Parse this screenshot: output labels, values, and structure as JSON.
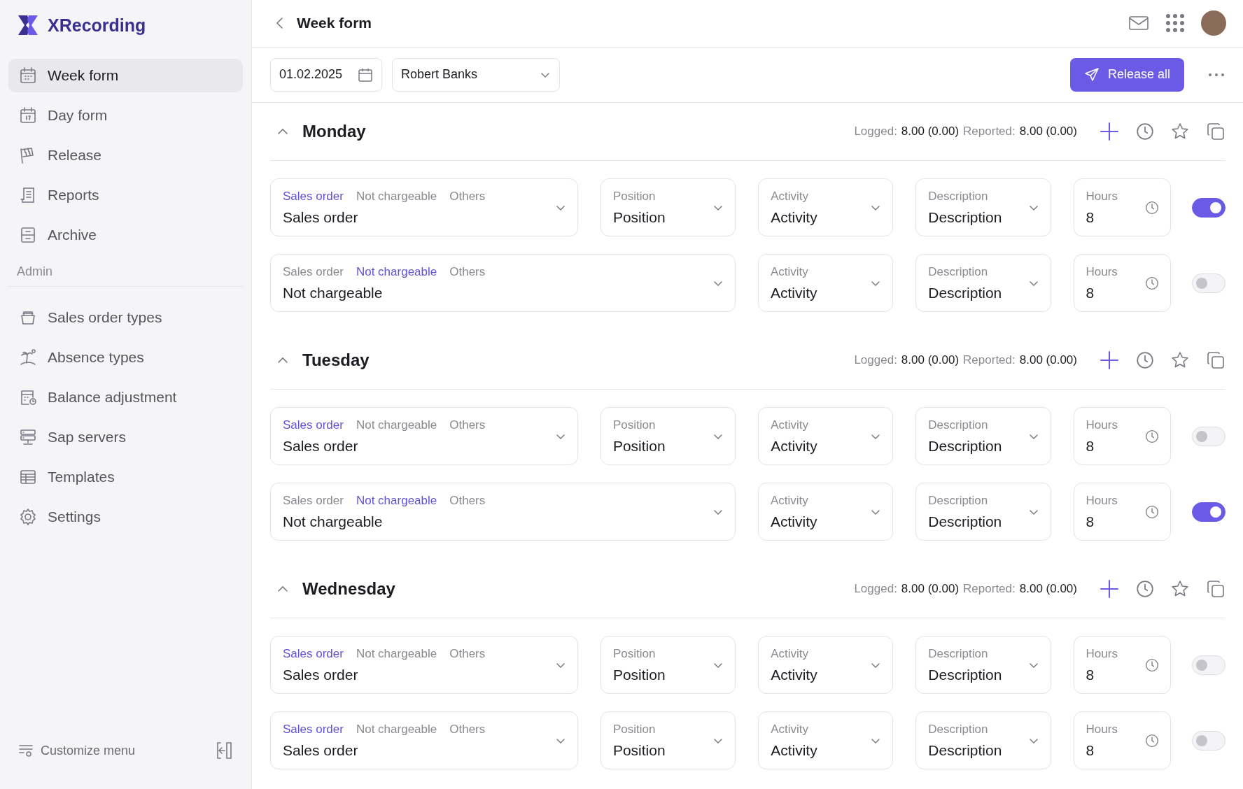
{
  "app": {
    "name": "XRecording"
  },
  "sidebar": {
    "items": [
      {
        "label": "Week form",
        "selected": true
      },
      {
        "label": "Day form",
        "selected": false
      },
      {
        "label": "Release",
        "selected": false
      },
      {
        "label": "Reports",
        "selected": false
      },
      {
        "label": "Archive",
        "selected": false
      }
    ],
    "admin_label": "Admin",
    "admin_items": [
      {
        "label": "Sales order types",
        "selected": false
      },
      {
        "label": "Absence types",
        "selected": false
      },
      {
        "label": "Balance adjustment",
        "selected": false
      },
      {
        "label": "Sap servers",
        "selected": false
      },
      {
        "label": "Templates",
        "selected": false
      },
      {
        "label": "Settings",
        "selected": false
      }
    ],
    "footer": {
      "label": "Customize menu"
    }
  },
  "header": {
    "title": "Week form"
  },
  "toolbar": {
    "date": "01.02.2025",
    "person": "Robert Banks",
    "release_button": "Release all"
  },
  "days": [
    {
      "name": "Monday",
      "expanded": true,
      "stats": [
        {
          "label": "Logged:",
          "value": "8.00 (0.00)"
        },
        {
          "label": "Reported:",
          "value": "8.00 (0.00)"
        }
      ],
      "entries": [
        {
          "kind": "sales_order",
          "segments": [
            {
              "label": "Sales order",
              "selected": true
            },
            {
              "label": "Not chargeable",
              "selected": false
            },
            {
              "label": "Others",
              "selected": false
            }
          ],
          "value": "Sales order",
          "position": {
            "label": "Position",
            "value": "Position"
          },
          "activity": {
            "label": "Activity",
            "value": "Activity"
          },
          "description": {
            "label": "Description",
            "value": "Description"
          },
          "hours": {
            "label": "Hours",
            "value": "8"
          },
          "on": true
        },
        {
          "kind": "not_chargeable",
          "segments": [
            {
              "label": "Sales order",
              "selected": false
            },
            {
              "label": "Not chargeable",
              "selected": true
            },
            {
              "label": "Others",
              "selected": false
            }
          ],
          "value": "Not chargeable",
          "activity": {
            "label": "Activity",
            "value": "Activity"
          },
          "description": {
            "label": "Description",
            "value": "Description"
          },
          "hours": {
            "label": "Hours",
            "value": "8"
          },
          "on": false
        }
      ]
    },
    {
      "name": "Tuesday",
      "expanded": true,
      "stats": [
        {
          "label": "Logged:",
          "value": "8.00 (0.00)"
        },
        {
          "label": "Reported:",
          "value": "8.00 (0.00)"
        }
      ],
      "entries": [
        {
          "kind": "sales_order",
          "segments": [
            {
              "label": "Sales order",
              "selected": true
            },
            {
              "label": "Not chargeable",
              "selected": false
            },
            {
              "label": "Others",
              "selected": false
            }
          ],
          "value": "Sales order",
          "position": {
            "label": "Position",
            "value": "Position"
          },
          "activity": {
            "label": "Activity",
            "value": "Activity"
          },
          "description": {
            "label": "Description",
            "value": "Description"
          },
          "hours": {
            "label": "Hours",
            "value": "8"
          },
          "on": false
        },
        {
          "kind": "not_chargeable",
          "segments": [
            {
              "label": "Sales order",
              "selected": false
            },
            {
              "label": "Not chargeable",
              "selected": true
            },
            {
              "label": "Others",
              "selected": false
            }
          ],
          "value": "Not chargeable",
          "activity": {
            "label": "Activity",
            "value": "Activity"
          },
          "description": {
            "label": "Description",
            "value": "Description"
          },
          "hours": {
            "label": "Hours",
            "value": "8"
          },
          "on": true
        }
      ]
    },
    {
      "name": "Wednesday",
      "expanded": true,
      "stats": [
        {
          "label": "Logged:",
          "value": "8.00 (0.00)"
        },
        {
          "label": "Reported:",
          "value": "8.00 (0.00)"
        }
      ],
      "entries": [
        {
          "kind": "sales_order",
          "segments": [
            {
              "label": "Sales order",
              "selected": true
            },
            {
              "label": "Not chargeable",
              "selected": false
            },
            {
              "label": "Others",
              "selected": false
            }
          ],
          "value": "Sales order",
          "position": {
            "label": "Position",
            "value": "Position"
          },
          "activity": {
            "label": "Activity",
            "value": "Activity"
          },
          "description": {
            "label": "Description",
            "value": "Description"
          },
          "hours": {
            "label": "Hours",
            "value": "8"
          },
          "on": false
        },
        {
          "kind": "sales_order",
          "segments": [
            {
              "label": "Sales order",
              "selected": true
            },
            {
              "label": "Not chargeable",
              "selected": false
            },
            {
              "label": "Others",
              "selected": false
            }
          ],
          "value": "Sales order",
          "position": {
            "label": "Position",
            "value": "Position"
          },
          "activity": {
            "label": "Activity",
            "value": "Activity"
          },
          "description": {
            "label": "Description",
            "value": "Description"
          },
          "hours": {
            "label": "Hours",
            "value": "8"
          },
          "on": false
        }
      ]
    }
  ]
}
